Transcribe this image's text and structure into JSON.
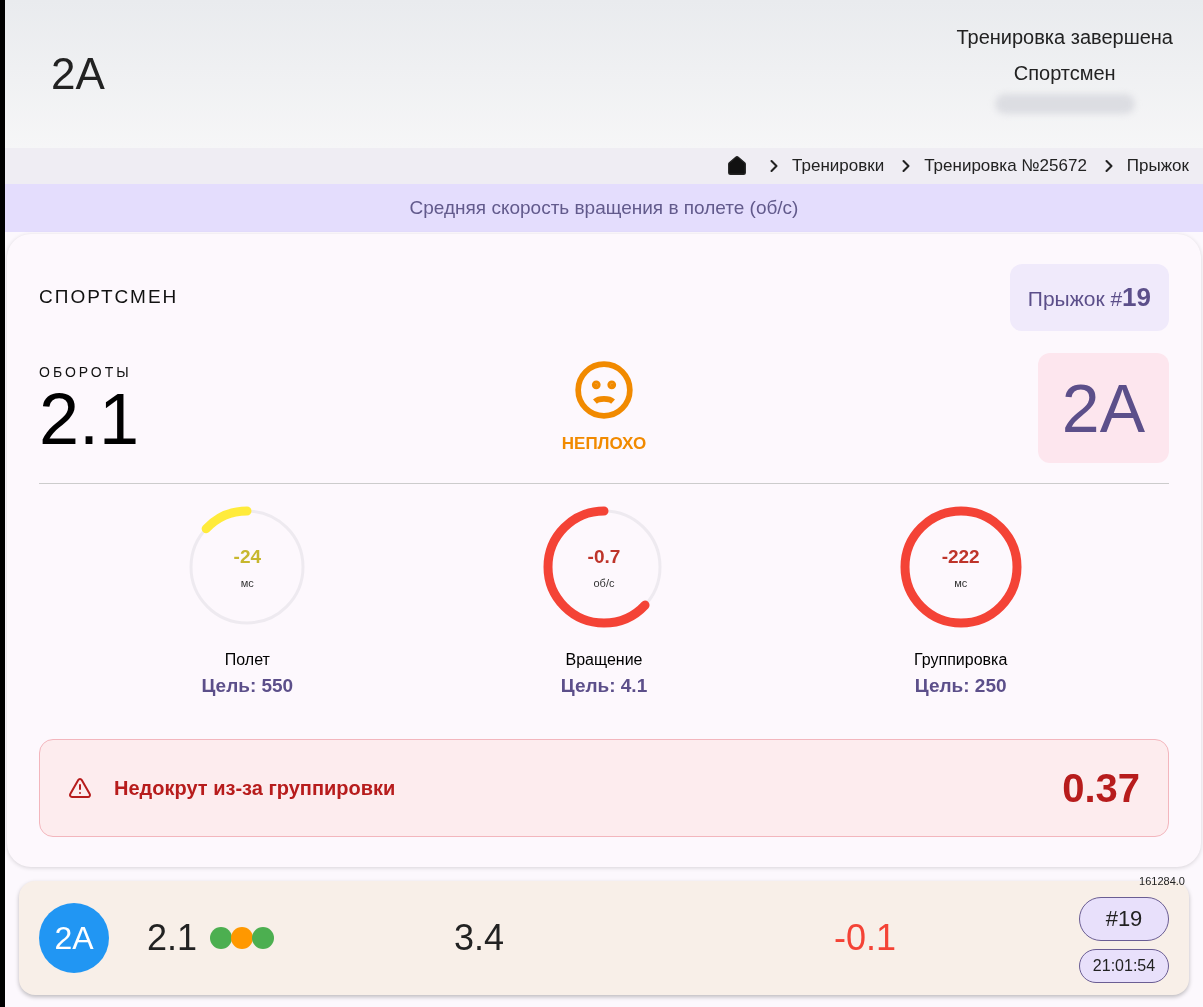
{
  "header": {
    "title": "2A",
    "status": "Тренировка завершена",
    "athlete": "Спортсмен"
  },
  "breadcrumbs": [
    "Тренировки",
    "Тренировка №25672",
    "Прыжок"
  ],
  "metric_banner": "Средняя скорость вращения в полете (об/с)",
  "card": {
    "athlete_label": "СПОРТСМЕН",
    "jump_label": "Прыжок #",
    "jump_number": "19",
    "rotations_label": "ОБОРОТЫ",
    "rotations_value": "2.1",
    "rating": "НЕПЛОХО",
    "jump_type": "2A",
    "gauges": [
      {
        "value": "-24",
        "unit": "мс",
        "name": "Полет",
        "target": "Цель: 550",
        "level": 0.13,
        "color": "#ffeb3b"
      },
      {
        "value": "-0.7",
        "unit": "об/с",
        "name": "Вращение",
        "target": "Цель: 4.1",
        "level": 0.63,
        "color": "#f44336"
      },
      {
        "value": "-222",
        "unit": "мс",
        "name": "Группировка",
        "target": "Цель: 250",
        "level": 1,
        "color": "#f44336"
      }
    ],
    "alert": {
      "text": "Недокрут из-за группировки",
      "value": "0.37"
    }
  },
  "jump_row": {
    "id_text": "161284.0",
    "type": "2A",
    "rotations": "2.1",
    "dots": [
      {
        "color": "#4caf50"
      },
      {
        "color": "#ff9800"
      },
      {
        "color": "#4caf50"
      }
    ],
    "speed": "3.4",
    "delta": "-0.1",
    "number": "#19",
    "time": "21:01:54"
  }
}
